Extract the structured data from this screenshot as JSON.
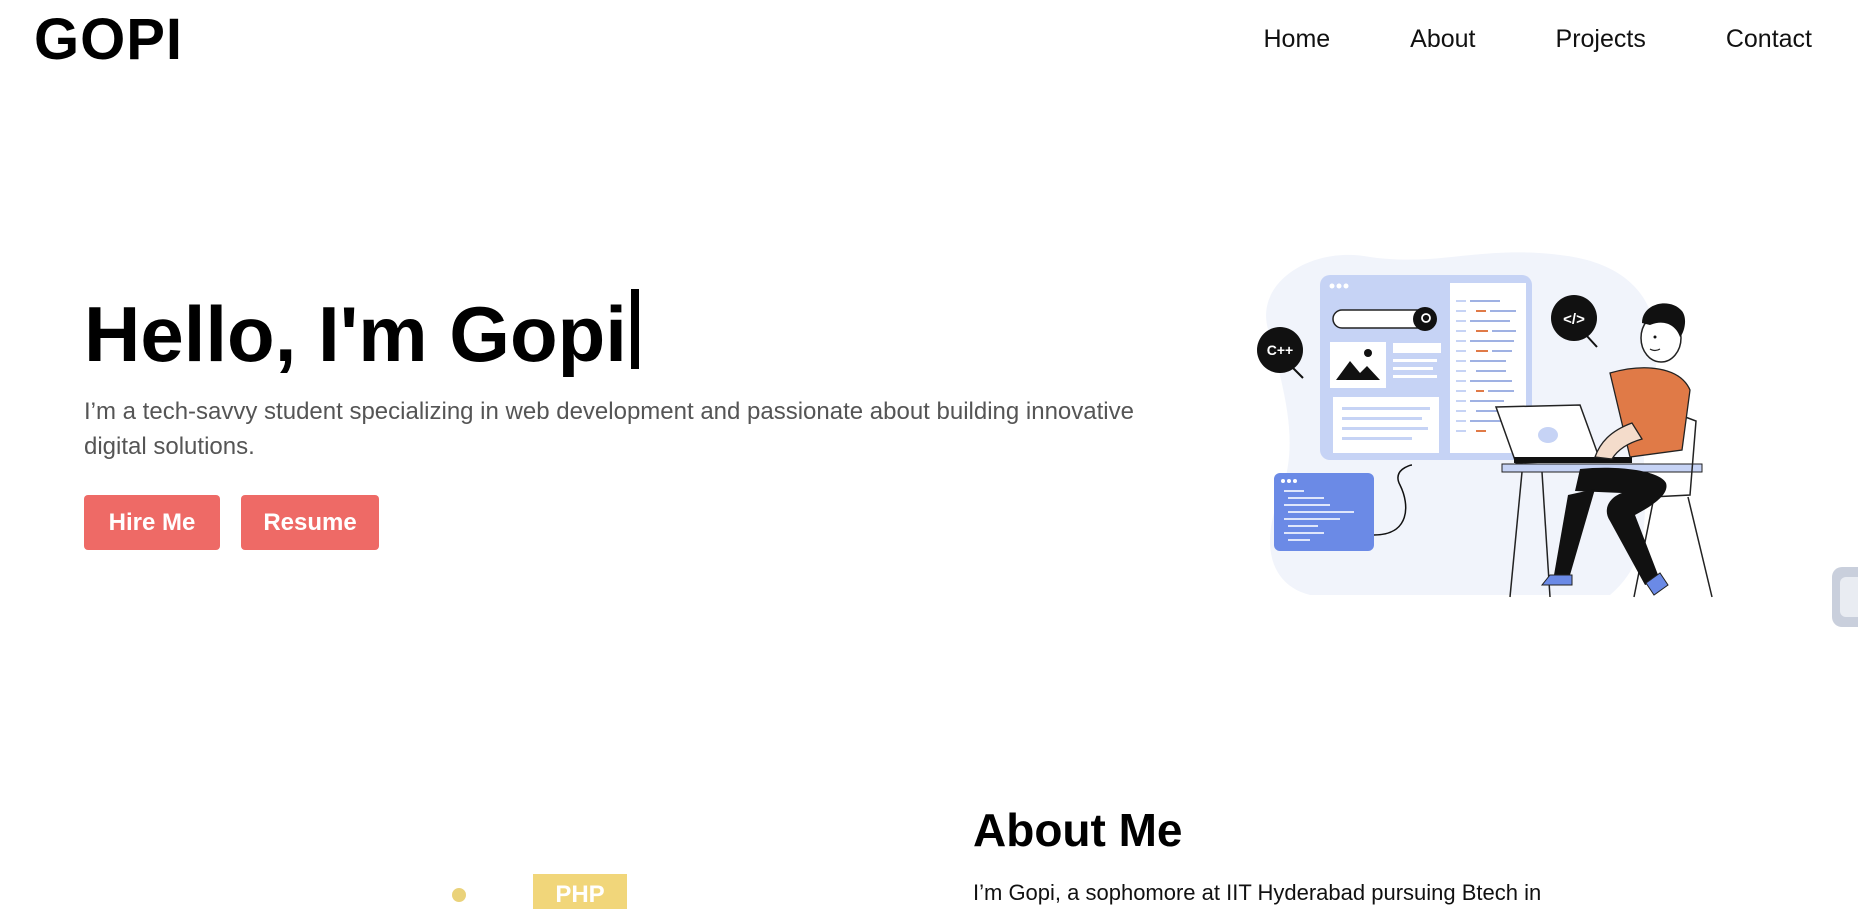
{
  "brand": {
    "logo_text": "GOPI"
  },
  "nav": {
    "items": [
      {
        "label": "Home"
      },
      {
        "label": "About"
      },
      {
        "label": "Projects"
      },
      {
        "label": "Contact"
      }
    ]
  },
  "hero": {
    "title": "Hello, I'm Gopi",
    "subtitle": "I’m a tech-savvy student specializing in web development and passionate about building innovative digital solutions.",
    "hire_label": "Hire Me",
    "resume_label": "Resume",
    "illustration": {
      "badge_cpp": "C++",
      "badge_code": "</>"
    }
  },
  "about": {
    "title": "About Me",
    "text": "I’m Gopi, a sophomore at IIT Hyderabad pursuing Btech in",
    "tag_php": "PHP"
  },
  "colors": {
    "accent": "#ee6a66",
    "text_muted": "#555555",
    "illustration_blue": "#c6d3f5",
    "illustration_orange": "#e07a47"
  }
}
